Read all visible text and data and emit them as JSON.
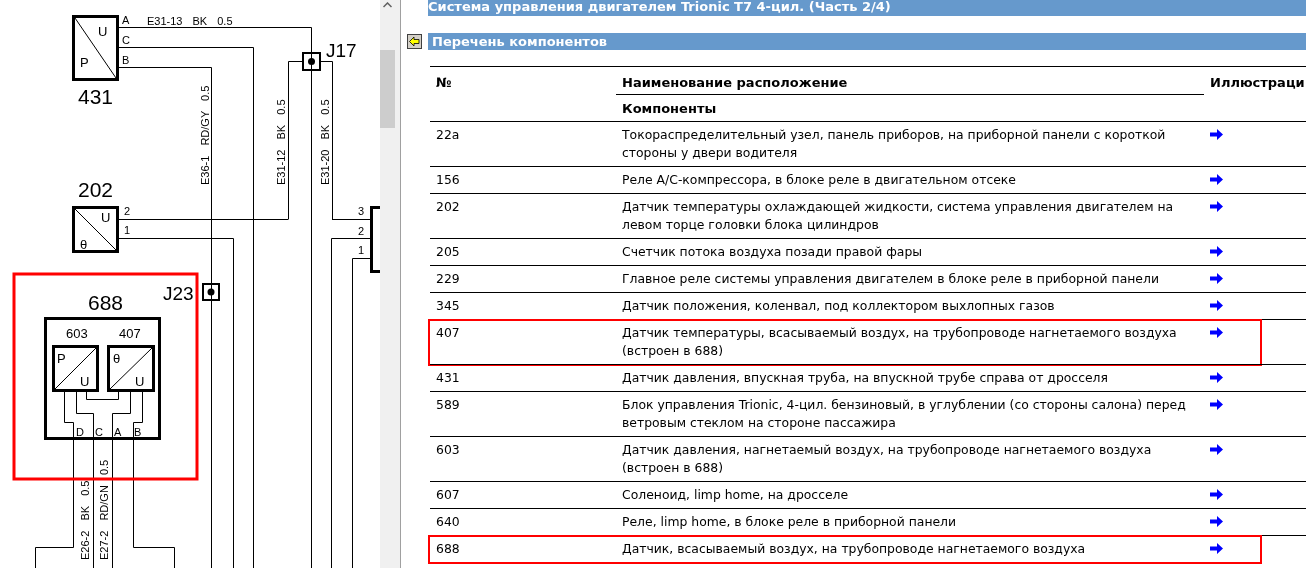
{
  "diagram": {
    "components": [
      {
        "number": "431",
        "symbols": [
          "U",
          "P"
        ],
        "pins": [
          "A",
          "C",
          "B"
        ],
        "highlighted": false
      },
      {
        "number": "202",
        "symbols": [
          "U",
          "θ"
        ],
        "pins": [
          "2",
          "1"
        ],
        "highlighted": false
      },
      {
        "number": "688",
        "highlighted": true,
        "pins": [
          "D",
          "C",
          "A",
          "B"
        ],
        "parts": [
          {
            "number": "603",
            "symbols": [
              "P",
              "U"
            ]
          },
          {
            "number": "407",
            "symbols": [
              "θ",
              "U"
            ]
          }
        ]
      }
    ],
    "connector_pins": [
      "3",
      "2",
      "1"
    ],
    "junctions": [
      "J17",
      "J23"
    ],
    "wires": [
      "E31-13 BK 0.5",
      "E36-1 RD/GY 0.5",
      "E31-12 BK 0.5",
      "E31-20 BK 0.5",
      "E26-2 BK 0.5",
      "E27-2 RD/GN 0.5"
    ]
  },
  "document": {
    "title": "Система управления двигателем Trionic T7 4-цил. (Часть 2/4)",
    "section": "Перечень компонентов",
    "columns": [
      "№",
      "Наименование расположение",
      "Иллюстраци"
    ],
    "group": "Компоненты",
    "rows": [
      {
        "number": "22a",
        "name": "Токораспределительный узел, панель приборов, на приборной панели с короткой стороны у двери водителя",
        "highlighted": false
      },
      {
        "number": "156",
        "name": "Реле A/C-компрессора, в блоке реле в двигательном отсеке",
        "highlighted": false
      },
      {
        "number": "202",
        "name": "Датчик температуры охлаждающей жидкости, система управления двигателем на левом торце головки блока цилиндров",
        "highlighted": false
      },
      {
        "number": "205",
        "name": "Счетчик потока воздуха позади правой фары",
        "highlighted": false
      },
      {
        "number": "229",
        "name": "Главное реле системы управления двигателем в блоке реле в приборной панели",
        "highlighted": false
      },
      {
        "number": "345",
        "name": "Датчик положения, коленвал, под коллектором выхлопных газов",
        "highlighted": false
      },
      {
        "number": "407",
        "name": "Датчик температуры, всасываемый воздух, на трубопроводе нагнетаемого воздуха (встроен в 688)",
        "highlighted": true
      },
      {
        "number": "431",
        "name": "Датчик давления, впускная труба, на впускной трубе справа от дросселя",
        "highlighted": false
      },
      {
        "number": "589",
        "name": "Блок управления Trionic, 4-цил. бензиновый, в углублении (со стороны салона) перед ветровым стеклом на стороне пассажира",
        "highlighted": false
      },
      {
        "number": "603",
        "name": "Датчик давления, нагнетаемый воздух, на трубопроводе нагнетаемого воздуха (встроен в 688)",
        "highlighted": false
      },
      {
        "number": "607",
        "name": "Соленоид, limp home, на дросселе",
        "highlighted": false
      },
      {
        "number": "640",
        "name": "Реле, limp home, в блоке реле в приборной панели",
        "highlighted": false
      },
      {
        "number": "688",
        "name": "Датчик, всасываемый воздух, на трубопроводе нагнетаемого воздуха",
        "highlighted": true
      }
    ]
  }
}
